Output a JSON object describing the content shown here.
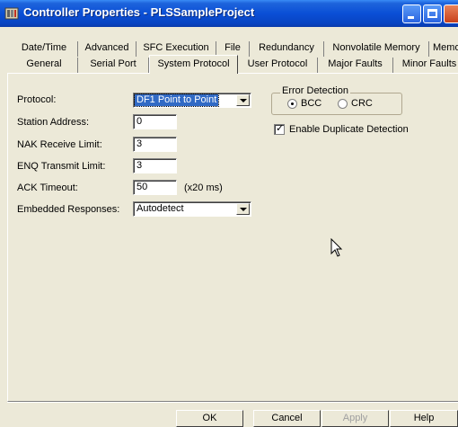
{
  "window": {
    "title": "Controller Properties - PLSSampleProject"
  },
  "tabs": {
    "row1": [
      {
        "label": "Date/Time"
      },
      {
        "label": "Advanced"
      },
      {
        "label": "SFC Execution"
      },
      {
        "label": "File"
      },
      {
        "label": "Redundancy"
      },
      {
        "label": "Nonvolatile Memory"
      },
      {
        "label": "Memory"
      }
    ],
    "row2": [
      {
        "label": "General"
      },
      {
        "label": "Serial Port"
      },
      {
        "label": "System Protocol",
        "active": true
      },
      {
        "label": "User Protocol"
      },
      {
        "label": "Major Faults"
      },
      {
        "label": "Minor Faults"
      }
    ]
  },
  "form": {
    "protocol": {
      "label": "Protocol:",
      "value": "DF1 Point to Point"
    },
    "station_address": {
      "label": "Station Address:",
      "value": "0"
    },
    "nak_receive_limit": {
      "label": "NAK Receive Limit:",
      "value": "3"
    },
    "enq_transmit_limit": {
      "label": "ENQ Transmit Limit:",
      "value": "3"
    },
    "ack_timeout": {
      "label": "ACK Timeout:",
      "value": "50",
      "unit": "(x20 ms)"
    },
    "embedded_responses": {
      "label": "Embedded Responses:",
      "value": "Autodetect"
    },
    "error_detection": {
      "title": "Error Detection",
      "options": [
        "BCC",
        "CRC"
      ],
      "selected": "BCC"
    },
    "duplicate_detection": {
      "label": "Enable Duplicate Detection",
      "checked": true
    }
  },
  "buttons": {
    "ok": "OK",
    "cancel": "Cancel",
    "apply": "Apply",
    "help": "Help"
  }
}
